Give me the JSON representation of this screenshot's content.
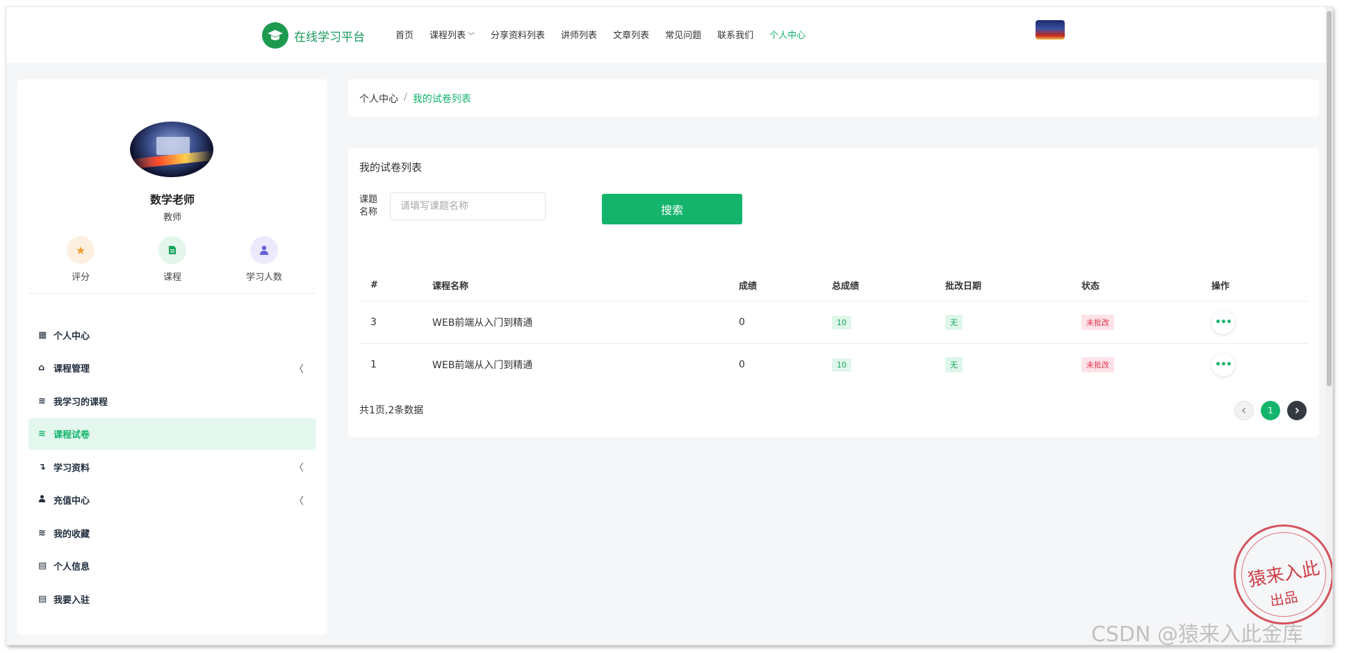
{
  "header": {
    "brand_name": "在线学习平台",
    "nav": [
      {
        "label": "首页",
        "active": false
      },
      {
        "label": "课程列表",
        "active": false,
        "has_dropdown": true
      },
      {
        "label": "分享资料列表",
        "active": false
      },
      {
        "label": "讲师列表",
        "active": false
      },
      {
        "label": "文章列表",
        "active": false
      },
      {
        "label": "常见问题",
        "active": false
      },
      {
        "label": "联系我们",
        "active": false
      },
      {
        "label": "个人中心",
        "active": true
      }
    ]
  },
  "sidebar": {
    "profile": {
      "name": "数学老师",
      "role": "教师"
    },
    "stats": [
      {
        "label": "评分",
        "icon": "star-icon",
        "color": "#f39a2c",
        "bg": "#fdf0e1"
      },
      {
        "label": "课程",
        "icon": "document-icon",
        "color": "#16a45f",
        "bg": "#e2f6ea"
      },
      {
        "label": "学习人数",
        "icon": "user-icon",
        "color": "#6b5fd6",
        "bg": "#ebe9fb"
      }
    ],
    "menu": [
      {
        "label": "个人中心",
        "icon": "grid-icon",
        "glyph": "▦",
        "active": false,
        "expandable": false
      },
      {
        "label": "课程管理",
        "icon": "basket-icon",
        "glyph": "⌂",
        "active": false,
        "expandable": true
      },
      {
        "label": "我学习的课程",
        "icon": "layers-icon",
        "glyph": "≋",
        "active": false,
        "expandable": false
      },
      {
        "label": "课程试卷",
        "icon": "layers-icon",
        "glyph": "≋",
        "active": true,
        "expandable": false
      },
      {
        "label": "学习资料",
        "icon": "level-down-icon",
        "glyph": "↴",
        "active": false,
        "expandable": true
      },
      {
        "label": "充值中心",
        "icon": "user-icon",
        "glyph": "●",
        "active": false,
        "expandable": true
      },
      {
        "label": "我的收藏",
        "icon": "layers-icon",
        "glyph": "≋",
        "active": false,
        "expandable": false
      },
      {
        "label": "个人信息",
        "icon": "id-card-icon",
        "glyph": "▤",
        "active": false,
        "expandable": false
      },
      {
        "label": "我要入驻",
        "icon": "id-card-icon",
        "glyph": "▤",
        "active": false,
        "expandable": false
      }
    ]
  },
  "breadcrumb": {
    "home": "个人中心",
    "separator": "/",
    "current": "我的试卷列表"
  },
  "main": {
    "title": "我的试卷列表",
    "search": {
      "label": "课题名称",
      "placeholder": "请填写课题名称",
      "value": "",
      "button": "搜索"
    },
    "table": {
      "columns": [
        "#",
        "课程名称",
        "成绩",
        "总成绩",
        "批改日期",
        "状态",
        "操作"
      ],
      "rows": [
        {
          "id": "3",
          "course": "WEB前端从入门到精通",
          "score": "0",
          "total": "10",
          "date": "无",
          "status": "未批改"
        },
        {
          "id": "1",
          "course": "WEB前端从入门到精通",
          "score": "0",
          "total": "10",
          "date": "无",
          "status": "未批改"
        }
      ]
    },
    "summary": "共1页,2条数据",
    "pagination": {
      "current": "1"
    }
  },
  "watermark": {
    "stamp_line1": "猿来入此",
    "stamp_line2": "出品",
    "csdn": "CSDN @猿来入此金库"
  },
  "colors": {
    "accent": "#14b46c",
    "danger": "#e0324f"
  }
}
